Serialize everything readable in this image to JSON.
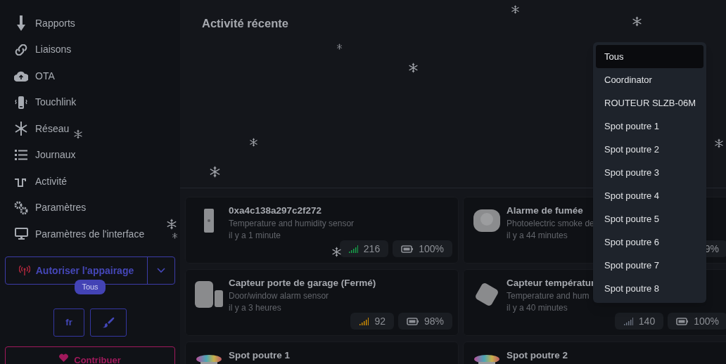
{
  "sidebar": {
    "items": [
      {
        "label": "Rapports"
      },
      {
        "label": "Liaisons"
      },
      {
        "label": "OTA"
      },
      {
        "label": "Touchlink"
      },
      {
        "label": "Réseau"
      },
      {
        "label": "Journaux"
      },
      {
        "label": "Activité"
      },
      {
        "label": "Paramètres"
      },
      {
        "label": "Paramètres de l'interface"
      }
    ],
    "permit_join": {
      "label": "Autoriser l'appairage",
      "target": "Tous"
    },
    "language": "fr",
    "contribute": "Contribuer"
  },
  "activity": {
    "title": "Activité récente"
  },
  "devices": [
    {
      "name": "0xa4c138a297c2f272",
      "description": "Temperature and humidity sensor",
      "last_seen": "il y a 1 minute",
      "badges": [
        {
          "kind": "signal",
          "value": "216",
          "color": "#16a34a"
        },
        {
          "kind": "battery",
          "value": "100%"
        }
      ]
    },
    {
      "name": "Alarme de fumée",
      "description": "Photoelectric smoke de",
      "last_seen": "il y a 44 minutes",
      "badges": [
        {
          "kind": "partial",
          "value": "9%"
        }
      ]
    },
    {
      "name": "Capteur porte de garage (Fermé)",
      "description": "Door/window alarm sensor",
      "last_seen": "il y a 3 heures",
      "badges": [
        {
          "kind": "signal",
          "value": "92",
          "color": "#ca8a04"
        },
        {
          "kind": "battery",
          "value": "98%"
        }
      ]
    },
    {
      "name": "Capteur températur",
      "description": "Temperature and hum",
      "last_seen": "il y a 40 minutes",
      "badges": [
        {
          "kind": "signal",
          "value": "140",
          "color": "#6b7280"
        },
        {
          "kind": "battery",
          "value": "100%"
        }
      ]
    },
    {
      "name": "Spot poutre 1"
    },
    {
      "name": "Spot poutre 2"
    }
  ],
  "device_filter": {
    "options": [
      {
        "label": "Tous",
        "selected": true
      },
      {
        "label": "Coordinator",
        "selected": false
      },
      {
        "label": "ROUTEUR SLZB-06M",
        "selected": false
      },
      {
        "label": "Spot poutre 1",
        "selected": false
      },
      {
        "label": "Spot poutre 2",
        "selected": false
      },
      {
        "label": "Spot poutre 3",
        "selected": false
      },
      {
        "label": "Spot poutre 4",
        "selected": false
      },
      {
        "label": "Spot poutre 5",
        "selected": false
      },
      {
        "label": "Spot poutre 6",
        "selected": false
      },
      {
        "label": "Spot poutre 7",
        "selected": false
      },
      {
        "label": "Spot poutre 8",
        "selected": false
      }
    ]
  }
}
